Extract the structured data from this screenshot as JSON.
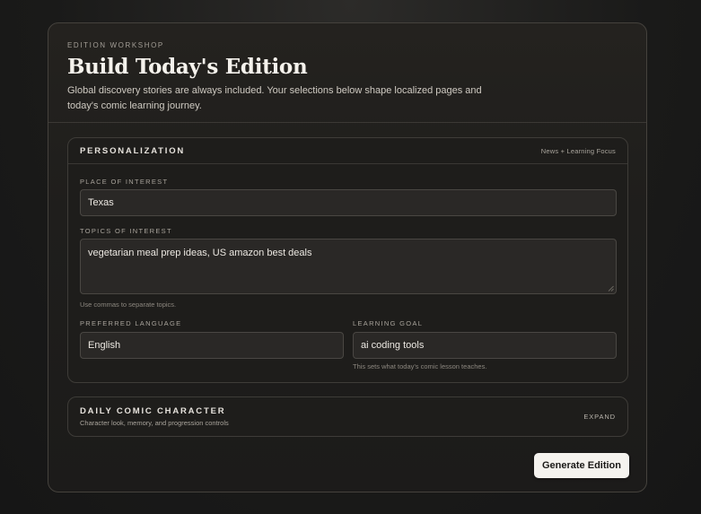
{
  "header": {
    "eyebrow": "EDITION WORKSHOP",
    "title": "Build Today's Edition",
    "subtitle": "Global discovery stories are always included. Your selections below shape localized pages and today's comic learning journey."
  },
  "personalization": {
    "title": "PERSONALIZATION",
    "meta": "News + Learning Focus",
    "place": {
      "label": "PLACE OF INTEREST",
      "value": "Texas"
    },
    "topics": {
      "label": "TOPICS OF INTEREST",
      "value": "vegetarian meal prep ideas, US amazon best deals",
      "hint": "Use commas to separate topics."
    },
    "language": {
      "label": "PREFERRED LANGUAGE",
      "value": "English"
    },
    "goal": {
      "label": "LEARNING GOAL",
      "value": "ai coding tools",
      "hint": "This sets what today's comic lesson teaches."
    }
  },
  "comic": {
    "title": "DAILY COMIC CHARACTER",
    "subtitle": "Character look, memory, and progression controls",
    "expand_label": "EXPAND"
  },
  "actions": {
    "generate_label": "Generate Edition"
  }
}
